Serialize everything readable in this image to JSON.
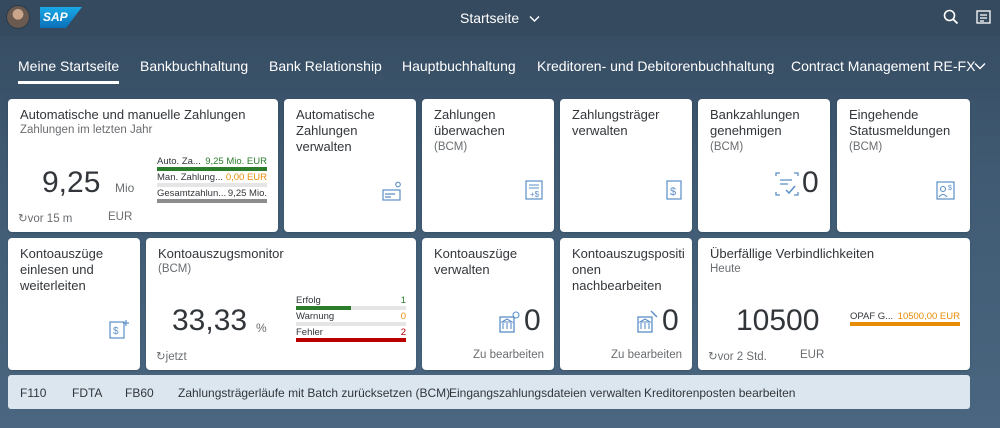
{
  "shell": {
    "logo": "SAP",
    "title": "Startseite"
  },
  "tabs": [
    {
      "label": "Meine Startseite",
      "active": true
    },
    {
      "label": "Bankbuchhaltung"
    },
    {
      "label": "Bank Relationship"
    },
    {
      "label": "Hauptbuchhaltung"
    },
    {
      "label": "Kreditoren- und Debitorenbuchhaltung"
    },
    {
      "label": "Contract Management RE-FX"
    }
  ],
  "tiles": {
    "zahlungen": {
      "title": "Automatische und manuelle Zahlungen",
      "subtitle": "Zahlungen im letzten Jahr",
      "value": "9,25",
      "scale": "Mio",
      "refresh": "vor 15 m",
      "currency": "EUR",
      "rows": [
        {
          "label": "Auto. Za...",
          "value": "9,25 Mio. EUR",
          "color": "#2b7d2b",
          "fill": 1.0
        },
        {
          "label": "Man. Zahlung...",
          "value": "0,00 EUR",
          "color": "#e78c07",
          "fill": 0.0
        },
        {
          "label": "Gesamtzahlun...",
          "value": "9,25 Mio.",
          "color": "#8c8c8c",
          "fill": 1.0
        }
      ]
    },
    "auto_verwalten": {
      "title": "Automatische Zahlungen verwalten"
    },
    "ueberwachen": {
      "title": "Zahlungen überwachen",
      "subtitle": "(BCM)"
    },
    "traeger": {
      "title": "Zahlungsträger verwalten"
    },
    "genehmigen": {
      "title": "Bankzahlungen genehmigen",
      "subtitle": "(BCM)",
      "value": "0"
    },
    "status": {
      "title": "Eingehende Statusmeldungen",
      "subtitle": "(BCM)"
    },
    "einlesen": {
      "title": "Kontoauszüge einlesen und weiterleiten"
    },
    "monitor": {
      "title": "Kontoauszugsmonitor",
      "subtitle": "(BCM)",
      "value": "33,33",
      "unit": "%",
      "refresh": "jetzt",
      "rows": [
        {
          "label": "Erfolg",
          "value": "1",
          "color": "#2b7d2b",
          "fill": 0.33
        },
        {
          "label": "Warnung",
          "value": "0",
          "color": "#e78c07",
          "fill": 0.0
        },
        {
          "label": "Fehler",
          "value": "2",
          "color": "#bb0000",
          "fill": 1.0
        }
      ]
    },
    "ka_verwalten": {
      "title": "Kontoauszüge verwalten",
      "value": "0",
      "footer": "Zu bearbeiten"
    },
    "positionen": {
      "title": "Kontoauszugspositi onen nachbearbeiten",
      "value": "0",
      "footer": "Zu bearbeiten"
    },
    "ueberfaellig": {
      "title": "Überfällige Verbindlichkeiten",
      "subtitle": "Heute",
      "value": "10500",
      "refresh": "vor 2 Std.",
      "currency": "EUR",
      "rows": [
        {
          "label": "OPAF G...",
          "value": "10500,00 EUR",
          "color": "#e78c07",
          "fill": 1.0
        }
      ]
    }
  },
  "links": [
    "F110",
    "FDTA",
    "FB60",
    "Zahlungsträgerläufe mit Batch zurücksetzen  (BCM)",
    "Eingangszahlungsdateien verwalten",
    "Kreditorenposten bearbeiten"
  ],
  "colors": {
    "shell": "#354a5f",
    "accent": "#0a6ed1",
    "icon": "#5b8fc7",
    "good": "#2b7d2b",
    "warning": "#e78c07",
    "error": "#bb0000"
  }
}
